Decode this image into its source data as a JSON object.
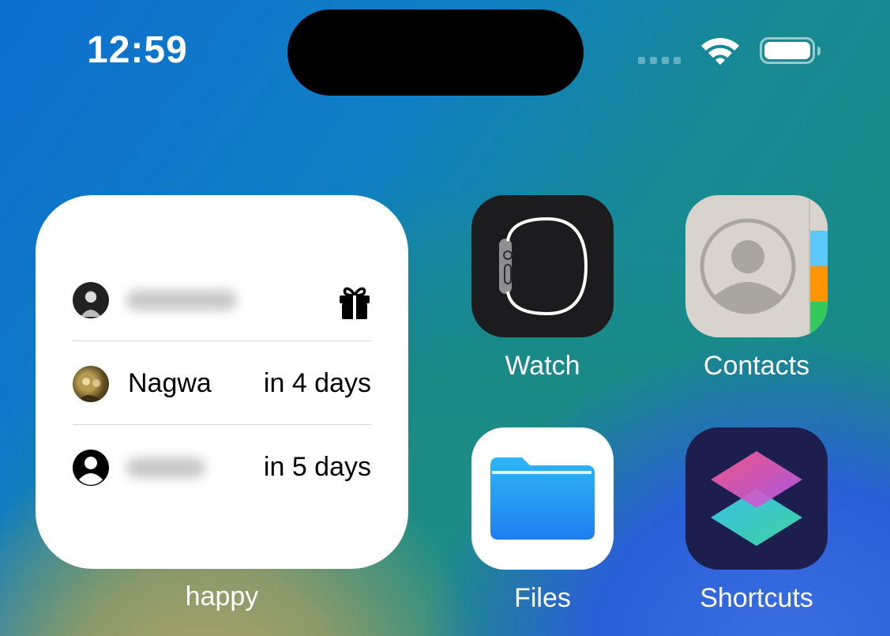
{
  "status_bar": {
    "time": "12:59",
    "icons": [
      "cellular-signal-icon",
      "wifi-icon",
      "battery-icon"
    ]
  },
  "widget": {
    "label": "happy",
    "rows": [
      {
        "name": "",
        "when": "",
        "avatar": "photo",
        "blurred_name": true,
        "trailing_icon": "gift-icon"
      },
      {
        "name": "Nagwa",
        "when": "in 4 days",
        "avatar": "photo"
      },
      {
        "name": "",
        "when": "in 5 days",
        "avatar": "person-placeholder",
        "blurred_name": true
      }
    ]
  },
  "apps": [
    {
      "label": "Watch",
      "icon": "watch-icon"
    },
    {
      "label": "Contacts",
      "icon": "contacts-icon"
    },
    {
      "label": "Files",
      "icon": "files-icon"
    },
    {
      "label": "Shortcuts",
      "icon": "shortcuts-icon"
    }
  ]
}
